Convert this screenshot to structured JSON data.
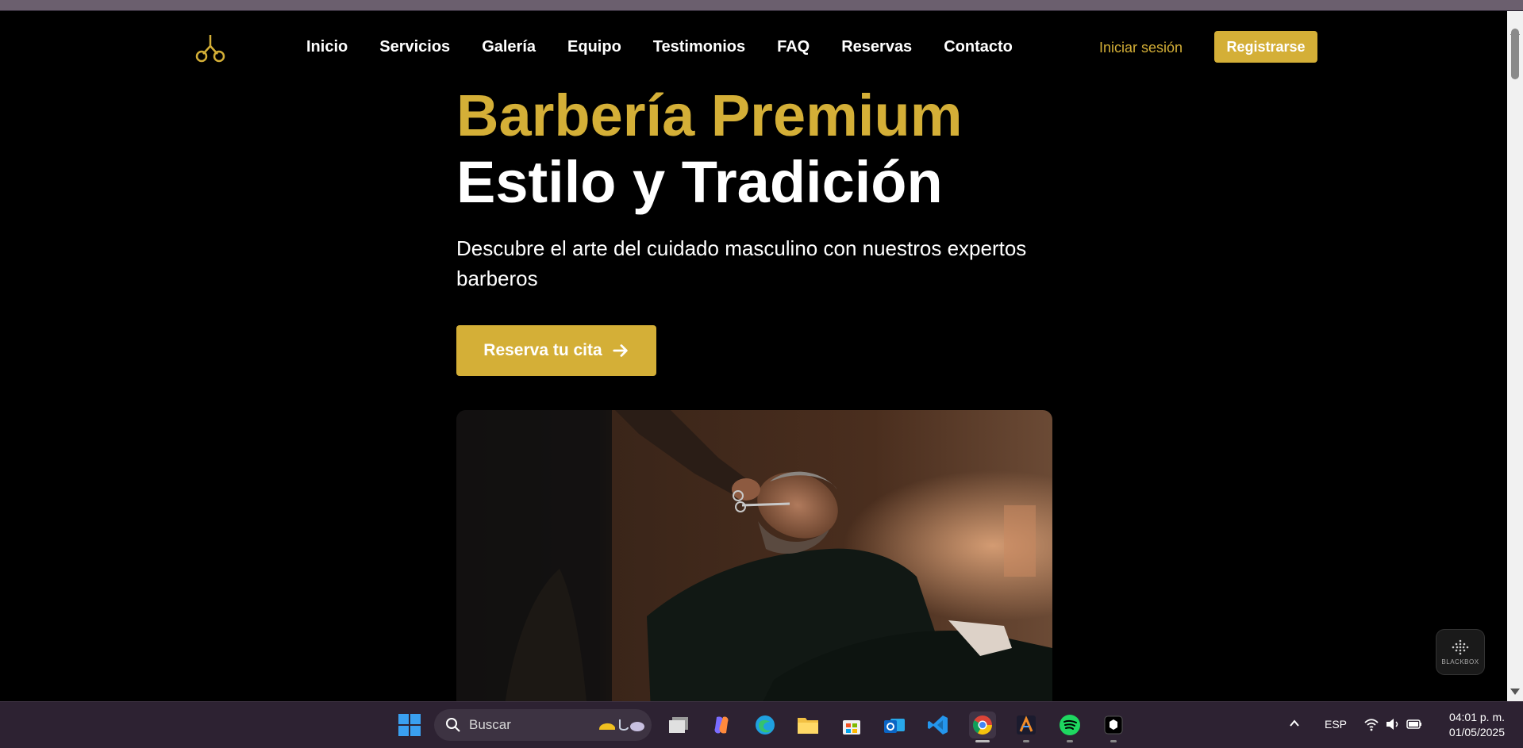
{
  "nav": {
    "links": [
      "Inicio",
      "Servicios",
      "Galería",
      "Equipo",
      "Testimonios",
      "FAQ",
      "Reservas",
      "Contacto"
    ],
    "login": "Iniciar sesión",
    "register": "Registrarse"
  },
  "hero": {
    "title_gold": "Barbería Premium",
    "title_white": "Estilo y Tradición",
    "subtitle": "Descubre el arte del cuidado masculino con nuestros expertos barberos",
    "cta": "Reserva tu cita"
  },
  "widget": {
    "label": "BLACKBOX"
  },
  "taskbar": {
    "search_placeholder": "Buscar",
    "apps": [
      "task-view",
      "copilot",
      "edge",
      "file-explorer",
      "microsoft-store",
      "outlook",
      "vs-code",
      "chrome",
      "arc-app",
      "spotify",
      "terminal-app"
    ],
    "language": "ESP",
    "time": "04:01 p. m.",
    "date": "01/05/2025"
  },
  "colors": {
    "accent": "#d4af37",
    "background": "#000000",
    "taskbar": "#2d2232"
  }
}
